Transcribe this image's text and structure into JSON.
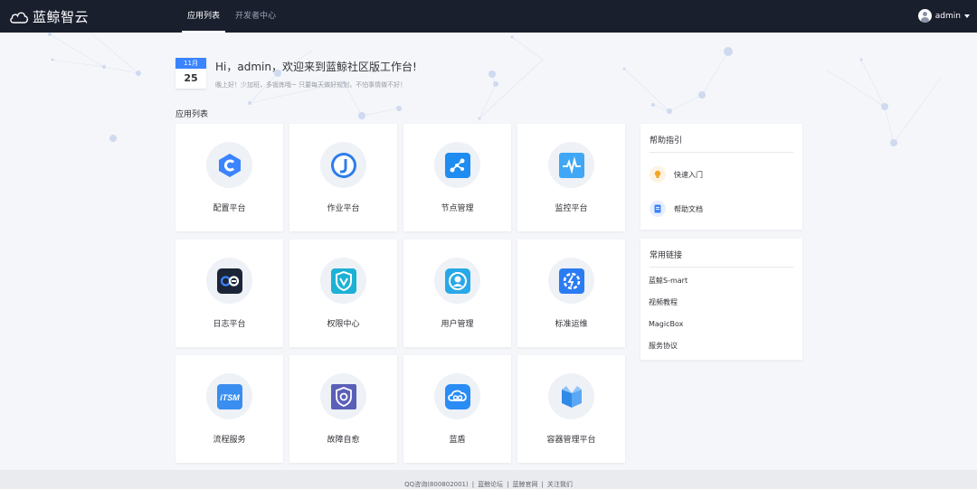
{
  "header": {
    "brand": "蓝鲸智云",
    "nav": [
      {
        "label": "应用列表",
        "active": true
      },
      {
        "label": "开发者中心",
        "active": false
      }
    ],
    "user": "admin"
  },
  "greeting": {
    "month": "11月",
    "day": "25",
    "title": "Hi，admin，欢迎来到蓝鲸社区版工作台!",
    "subtitle": "晚上好！少加班，多锻炼哦~ 只要每天做好规划，不怕事情做不好！"
  },
  "apps_section_label": "应用列表",
  "apps": [
    {
      "label": "配置平台",
      "icon": "config-platform-icon",
      "color": "#3a84ff"
    },
    {
      "label": "作业平台",
      "icon": "job-platform-icon",
      "color": "#2e7de9"
    },
    {
      "label": "节点管理",
      "icon": "node-management-icon",
      "color": "#1e8cf0"
    },
    {
      "label": "监控平台",
      "icon": "monitor-platform-icon",
      "color": "#3fa7f5"
    },
    {
      "label": "日志平台",
      "icon": "log-platform-icon",
      "color": "#1c2538"
    },
    {
      "label": "权限中心",
      "icon": "permission-center-icon",
      "color": "#1db1d6"
    },
    {
      "label": "用户管理",
      "icon": "user-management-icon",
      "color": "#28a8e8"
    },
    {
      "label": "标准运维",
      "icon": "standard-ops-icon",
      "color": "#2b7bf2"
    },
    {
      "label": "流程服务",
      "icon": "itsm-icon",
      "color": "#3a8ef0"
    },
    {
      "label": "故障自愈",
      "icon": "fault-self-healing-icon",
      "color": "#5a5fb8"
    },
    {
      "label": "蓝盾",
      "icon": "bluedun-icon",
      "color": "#2a8cf5"
    },
    {
      "label": "容器管理平台",
      "icon": "container-platform-icon",
      "color": "#2f8ae8"
    }
  ],
  "itsm_text": "iTSM",
  "help": {
    "title": "帮助指引",
    "items": [
      {
        "label": "快速入门",
        "icon": "lightbulb-icon",
        "bg": "#fdf3e3",
        "color": "#f5a623"
      },
      {
        "label": "帮助文档",
        "icon": "document-icon",
        "bg": "#e8efff",
        "color": "#3a84ff"
      }
    ]
  },
  "links": {
    "title": "常用链接",
    "items": [
      "蓝鲸S-mart",
      "视频教程",
      "MagicBox",
      "服务协议"
    ]
  },
  "footer": {
    "qq": "QQ咨询(800802001)",
    "forum": "蓝鲸论坛",
    "site": "蓝鲸官网",
    "follow": "关注我们",
    "separator": "|"
  }
}
